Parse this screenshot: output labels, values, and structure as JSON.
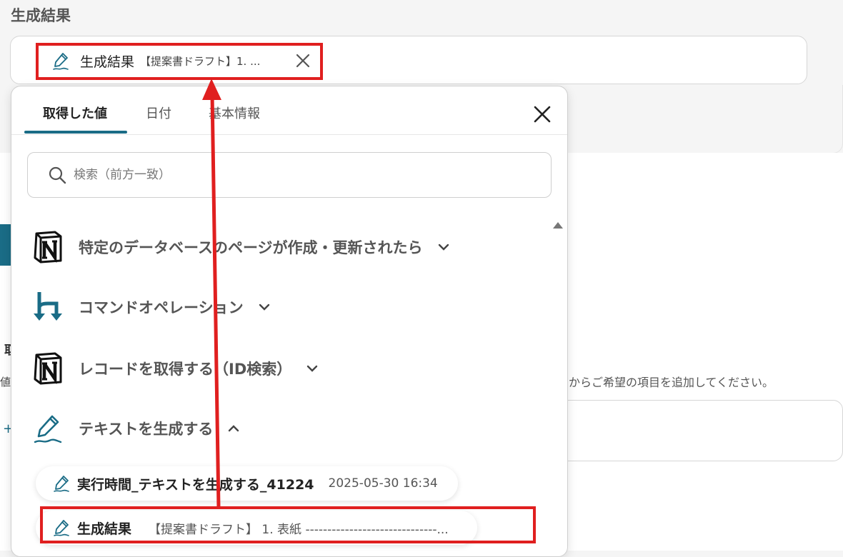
{
  "section_title": "生成結果",
  "selected_chip": {
    "label": "生成結果",
    "preview": "【提案書ドラフト】1. ...",
    "icon": "pen-icon",
    "close_icon": "close-icon"
  },
  "background": {
    "edge_text_a": "取",
    "edge_text_b": "値",
    "edge_text_c": "+",
    "help_text": "からご希望の項目を追加してください。"
  },
  "popup": {
    "tabs": [
      {
        "label": "取得した値",
        "active": true
      },
      {
        "label": "日付",
        "active": false
      },
      {
        "label": "基本情報",
        "active": false
      }
    ],
    "close_icon": "close-icon",
    "search": {
      "placeholder": "検索（前方一致）",
      "value": ""
    },
    "groups": [
      {
        "label": "特定のデータベースのページが作成・更新されたら",
        "icon": "notion-icon",
        "expanded": false
      },
      {
        "label": "コマンドオペレーション",
        "icon": "branch-icon",
        "expanded": false
      },
      {
        "label": "レコードを取得する（ID検索）",
        "icon": "notion-icon",
        "expanded": false
      },
      {
        "label": "テキストを生成する",
        "icon": "pen-icon",
        "expanded": true
      }
    ],
    "items": [
      {
        "label": "実行時間_テキストを生成する_41224",
        "value": "2025-05-30 16:34",
        "icon": "pen-icon"
      },
      {
        "label": "生成結果",
        "value": "【提案書ドラフト】 1. 表紙 ------------------------------...",
        "icon": "pen-icon"
      }
    ]
  },
  "colors": {
    "accent": "#1a6c86",
    "annotation": "#e01f1f"
  }
}
